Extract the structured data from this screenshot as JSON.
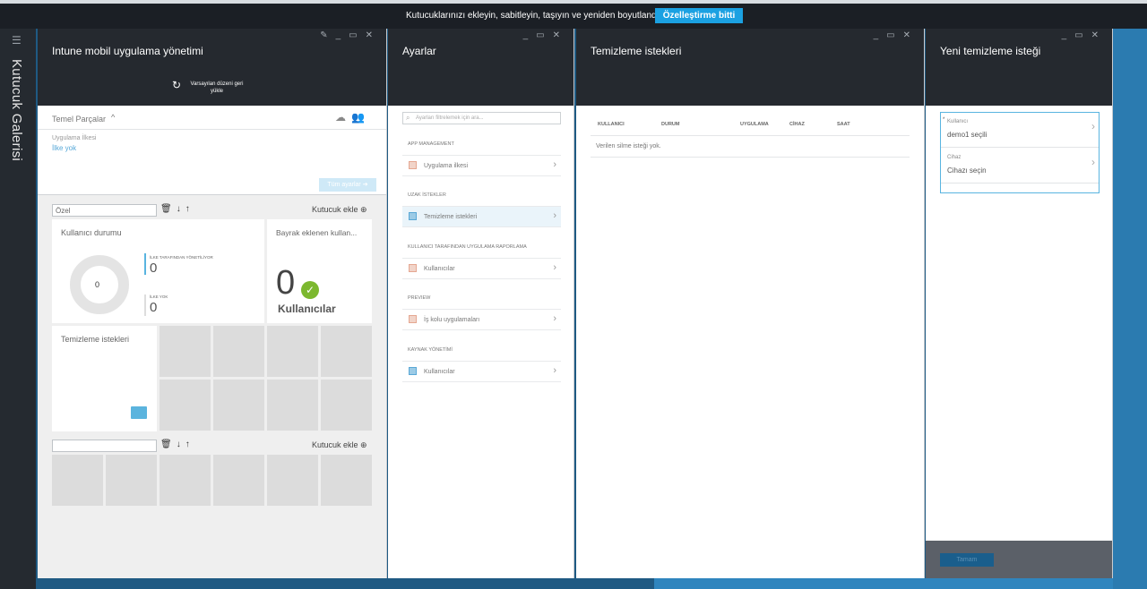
{
  "banner": {
    "message": "Kutucuklarınızı ekleyin, sabitleyin, taşıyın ve yeniden boyutlandırın.",
    "done_button": "Özelleştirme bitti"
  },
  "rail": {
    "title": "Kutucuk Galerisi"
  },
  "blade1": {
    "title": "Intune mobil uygulama yönetimi",
    "reset_label": "Varsayılan düzeni geri yükle",
    "essentials": {
      "title": "Temel Parçalar",
      "policy_label": "Uygulama İlkesi",
      "policy_value": "İlke yok",
      "all_settings": "Tüm ayarlar ➔"
    },
    "group1": {
      "input_value": "Özel",
      "add_tile": "Kutucuk ekle"
    },
    "group2": {
      "input_value": "",
      "add_tile": "Kutucuk ekle"
    },
    "tile_user_status": {
      "title": "Kullanıcı durumu",
      "donut_value": "0",
      "managed_label": "İLKE TARAFINDAN YÖNETİLİYOR",
      "managed_value": "0",
      "no_policy_label": "İLKE YOK",
      "no_policy_value": "0"
    },
    "tile_flagged": {
      "title": "Bayrak eklenen kullan...",
      "value": "0",
      "caption": "Kullanıcılar"
    },
    "tile_wipe": {
      "title": "Temizleme istekleri"
    }
  },
  "blade2": {
    "title": "Ayarlar",
    "search_placeholder": "Ayarları filtrelemek için ara...",
    "sections": [
      {
        "header": "APP MANAGEMENT",
        "items": [
          "Uygulama ilkesi"
        ]
      },
      {
        "header": "UZAK İSTEKLER",
        "items": [
          "Temizleme istekleri"
        ]
      },
      {
        "header": "KULLANICI TARAFINDAN UYGULAMA RAPORLAMA",
        "items": [
          "Kullanıcılar"
        ]
      },
      {
        "header": "PREVIEW",
        "items": [
          "İş kolu uygulamaları"
        ]
      },
      {
        "header": "KAYNAK YÖNETİMİ",
        "items": [
          "Kullanıcılar"
        ]
      }
    ]
  },
  "blade3": {
    "title": "Temizleme istekleri",
    "columns": [
      "KULLANICI",
      "DURUM",
      "UYGULAMA",
      "CİHAZ",
      "SAAT"
    ],
    "empty_text": "Verilen silme isteği yok."
  },
  "blade4": {
    "title": "Yeni temizleme isteği",
    "user_label": "Kullanıcı",
    "user_value": "demo1 seçili",
    "device_label": "Cihaz",
    "device_value": "Cihazı seçin",
    "ok_button": "Tamam"
  },
  "colors": {
    "accent": "#1ba1e2",
    "header_dark": "#25292f",
    "success": "#7cb82f"
  }
}
